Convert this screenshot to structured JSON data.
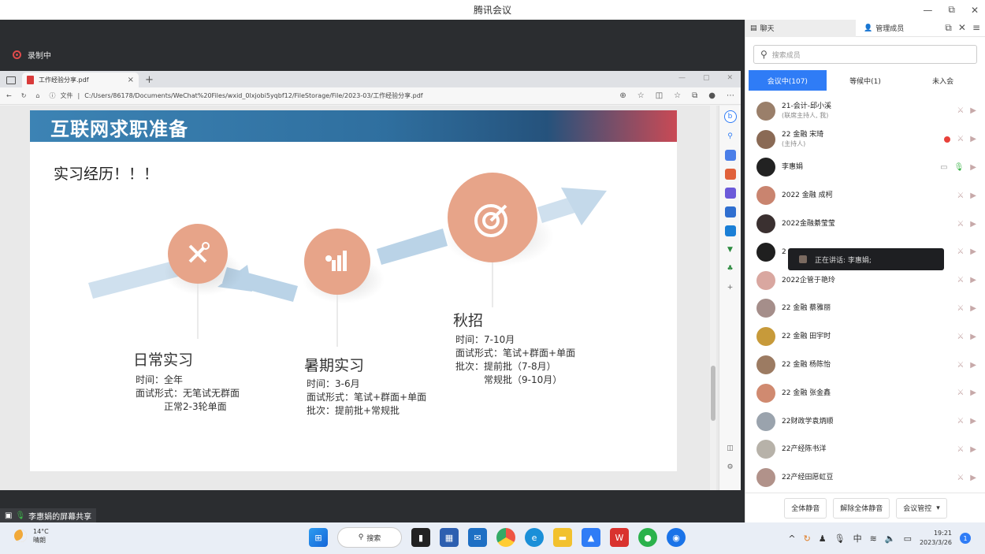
{
  "window": {
    "title": "腾讯会议",
    "minimize": "—",
    "restore": "⧉",
    "close": "✕"
  },
  "recording": {
    "label": "录制中"
  },
  "browser": {
    "tab_title": "工作经验分享.pdf",
    "file_label": "文件",
    "url": "C:/Users/86178/Documents/WeChat%20Files/wxid_0lxjobi5yqbf12/FileStorage/File/2023-03/工作经验分享.pdf"
  },
  "slide": {
    "header": "互联网求职准备",
    "subtitle": "实习经历！！！",
    "stages": [
      {
        "title": "日常实习",
        "lines": [
          "时间：全年",
          "面试形式：无笔试无群面",
          "　　　正常2-3轮单面"
        ]
      },
      {
        "title": "暑期实习",
        "lines": [
          "时间：3-6月",
          "面试形式：笔试+群面+单面",
          "批次：提前批+常规批"
        ]
      },
      {
        "title": "秋招",
        "lines": [
          "时间：7-10月",
          "面试形式：笔试+群面+单面",
          "批次：提前批（7-8月）",
          "　　　常规批（9-10月）"
        ]
      }
    ]
  },
  "share_label": "李惠娟的屏幕共享",
  "panel": {
    "tab_chat": "聊天",
    "tab_manage": "管理成员",
    "search_placeholder": "搜索成员",
    "status_tabs": [
      "会议中(107)",
      "等候中(1)",
      "未入会"
    ],
    "members": [
      {
        "name": "21-会计-邱小溪",
        "role": "(联席主持人, 我)",
        "color": "#9a7f6a"
      },
      {
        "name": "22 金融 宋琦",
        "role": "(主持人)",
        "color": "#8a6a55"
      },
      {
        "name": "李惠娟",
        "role": "",
        "color": "#222222"
      },
      {
        "name": "2022 金融 成柯",
        "role": "",
        "color": "#c9846f"
      },
      {
        "name": "2022金融綦莹莹",
        "role": "",
        "color": "#3a3030"
      },
      {
        "name": "2",
        "role": "",
        "color": "#1f1f1f"
      },
      {
        "name": "2022企管于艳玲",
        "role": "",
        "color": "#d9a7a0"
      },
      {
        "name": "22 金融 蔡雅丽",
        "role": "",
        "color": "#a58e8a"
      },
      {
        "name": "22 金融 田宇时",
        "role": "",
        "color": "#c79a3a"
      },
      {
        "name": "22 金融 杨陈怡",
        "role": "",
        "color": "#9c7b62"
      },
      {
        "name": "22 金融 张金鑫",
        "role": "",
        "color": "#d08a70"
      },
      {
        "name": "22财政学袁炳顺",
        "role": "",
        "color": "#9aa3ad"
      },
      {
        "name": "22产经陈书洋",
        "role": "",
        "color": "#b7b2a9"
      },
      {
        "name": "22产经田愿虹豆",
        "role": "",
        "color": "#b1928a"
      }
    ],
    "speaking": "正在讲话: 李惠娟;",
    "btn_mute_all": "全体静音",
    "btn_unmute_all": "解除全体静音",
    "btn_control": "会议管控"
  },
  "taskbar": {
    "temp": "14°C",
    "weather": "晴朗",
    "search": "搜索",
    "ime": "中",
    "time": "19:21",
    "date": "2023/3/26",
    "notif_count": "1"
  }
}
